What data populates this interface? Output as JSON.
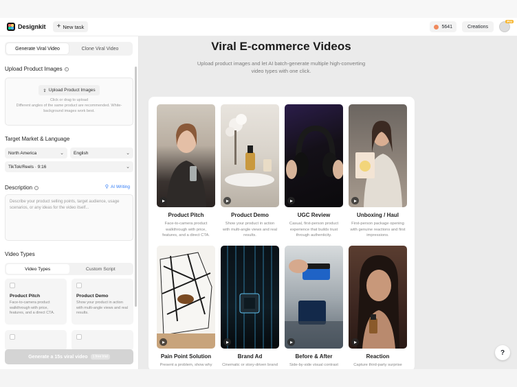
{
  "header": {
    "brand": "Designkit",
    "new_task_label": "New task",
    "credits": "5641",
    "creations_label": "Creations",
    "pro_badge": "Pro"
  },
  "sidebar": {
    "tabs": [
      "Generate Viral Video",
      "Clone Viral Video"
    ],
    "upload": {
      "title": "Upload Product Images",
      "button_label": "Upload Product Images",
      "hint_line1": "Click or drag to upload",
      "hint_line2": "Different angles of the same product are recommended. White-background images work best."
    },
    "market": {
      "title": "Target Market & Language",
      "region": "North America",
      "language": "English",
      "format": "TikTok/Reels · 9:16"
    },
    "description": {
      "title": "Description",
      "ai_writing": "AI Writing",
      "placeholder": "Describe your product selling points, target audience, usage scenarios, or any ideas for the video itself..."
    },
    "video_types": {
      "title": "Video Types",
      "tabs": [
        "Video Types",
        "Custom Script"
      ],
      "cards": [
        {
          "title": "Product Pitch",
          "desc": "Face-to-camera product walkthrough with price, features, and a direct CTA."
        },
        {
          "title": "Product Demo",
          "desc": "Show your product in action with multi-angle views and real results."
        }
      ]
    },
    "generate_label": "Generate a 15s viral video",
    "generate_badge": "1 free trial"
  },
  "main": {
    "title": "Viral E-commerce Videos",
    "subtitle": "Upload product images and let AI batch-generate multiple high-converting video types with one click.",
    "videos": [
      {
        "title": "Product Pitch",
        "desc": "Face-to-camera product walkthrough with price, features, and a direct CTA."
      },
      {
        "title": "Product Demo",
        "desc": "Show your product in action with multi-angle views and real results."
      },
      {
        "title": "UGC Review",
        "desc": "Casual, first-person product experience that builds trust through authenticity."
      },
      {
        "title": "Unboxing / Haul",
        "desc": "First-person package opening with genuine reactions and first impressions."
      },
      {
        "title": "Pain Point Solution",
        "desc": "Present a problem, show why old methods fail, then reveal"
      },
      {
        "title": "Brand Ad",
        "desc": "Cinematic or story-driven brand content with high"
      },
      {
        "title": "Before & After",
        "desc": "Side-by-side visual contrast showing the product's"
      },
      {
        "title": "Reaction",
        "desc": "Capture third-party surprise and admiration as social proof."
      }
    ]
  },
  "help_label": "?"
}
